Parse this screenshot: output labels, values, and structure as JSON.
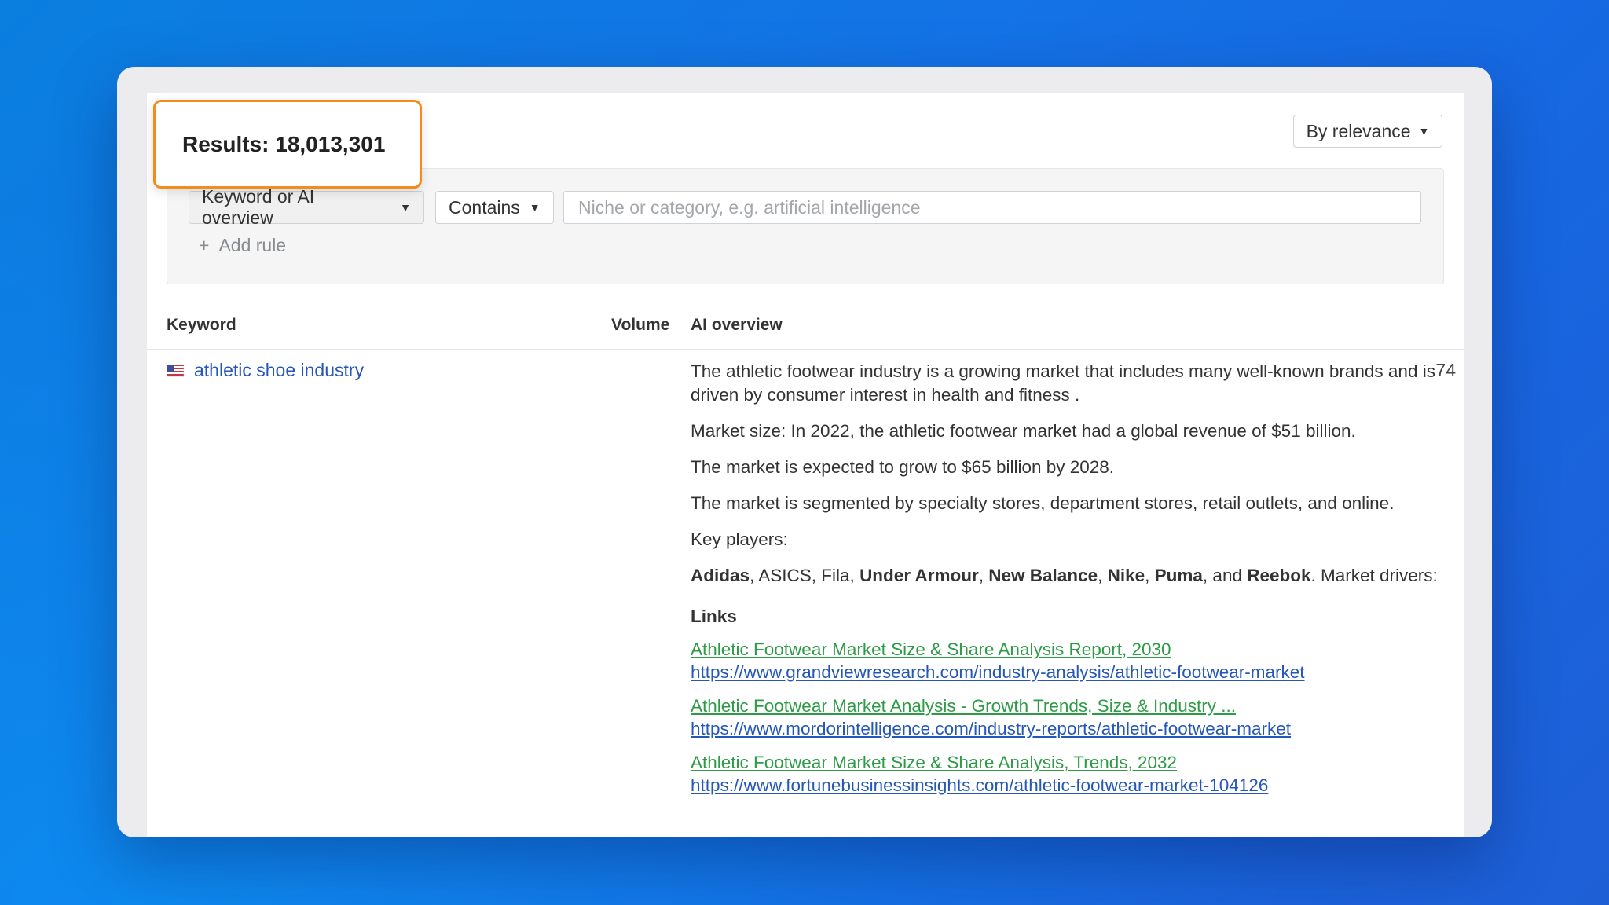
{
  "results": {
    "label": "Results: 18,013,301"
  },
  "sort": {
    "label": "By relevance"
  },
  "filter": {
    "field_label": "Keyword or AI overview",
    "operator_label": "Contains",
    "input_value": "",
    "input_placeholder": "Niche or category, e.g. artificial intelligence",
    "add_rule_label": "Add rule"
  },
  "table": {
    "headers": {
      "keyword": "Keyword",
      "volume": "Volume",
      "ai_overview": "AI overview"
    },
    "rows": [
      {
        "country_flag": "us-flag",
        "keyword": "athletic shoe industry",
        "volume": "74",
        "ai_overview": {
          "p1": "The athletic footwear industry is a growing market that includes many well-known brands and is driven by consumer interest in health and fitness .",
          "p2": "Market size: In 2022, the athletic footwear market had a global revenue of $51 billion.",
          "p3": "The market is expected to grow to $65 billion by 2028.",
          "p4": "The market is segmented by specialty stores, department stores, retail outlets, and online.",
          "p5": "Key players:",
          "players": {
            "adidas": "Adidas",
            "sep1": ", ASICS, Fila, ",
            "under_armour": "Under Armour",
            "sep2": ", ",
            "new_balance": "New Balance",
            "sep3": ", ",
            "nike": "Nike",
            "sep4": ", ",
            "puma": "Puma",
            "sep5": ", and ",
            "reebok": "Reebok",
            "tail": ". Market drivers:"
          },
          "links_title": "Links",
          "links": [
            {
              "title": "Athletic Footwear Market Size & Share Analysis Report, 2030",
              "url": "https://www.grandviewresearch.com/industry-analysis/athletic-footwear-market"
            },
            {
              "title": "Athletic Footwear Market Analysis - Growth Trends, Size & Industry ...",
              "url": "https://www.mordorintelligence.com/industry-reports/athletic-footwear-market"
            },
            {
              "title": "Athletic Footwear Market Size & Share Analysis, Trends, 2032",
              "url": "https://www.fortunebusinessinsights.com/athletic-footwear-market-104126"
            }
          ]
        }
      }
    ]
  },
  "colors": {
    "callout_border": "#f28c1a",
    "link_blue": "#2457b8",
    "link_green": "#2e9b46",
    "background_blue": "#1473e6"
  }
}
